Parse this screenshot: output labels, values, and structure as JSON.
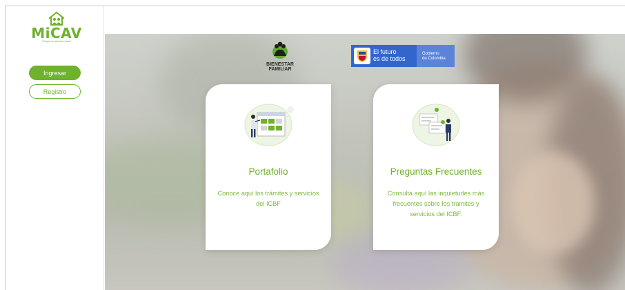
{
  "sidebar": {
    "logo_text": "MiCAV",
    "logo_tagline": "El lugar de atención virtual",
    "login_label": "Ingresar",
    "register_label": "Registro"
  },
  "header": {
    "bienestar_line1": "BIENESTAR",
    "bienestar_line2": "FAMILIAR",
    "gov_line1": "El futuro",
    "gov_line2": "es de todos",
    "gov_sub1": "Gobierno",
    "gov_sub2": "de Colombia"
  },
  "cards": [
    {
      "title": "Portafolio",
      "description": "Conoce aquí los trámites y servicios del ICBF",
      "illustration": "portfolio-illustration"
    },
    {
      "title": "Preguntas Frecuentes",
      "description": "Consulta aquí las inquietudes más frecuentes sobre los tramites y servicios del ICBF.",
      "illustration": "faq-illustration"
    }
  ],
  "colors": {
    "brand_green": "#6fb22b",
    "gov_blue": "#3366cc"
  }
}
